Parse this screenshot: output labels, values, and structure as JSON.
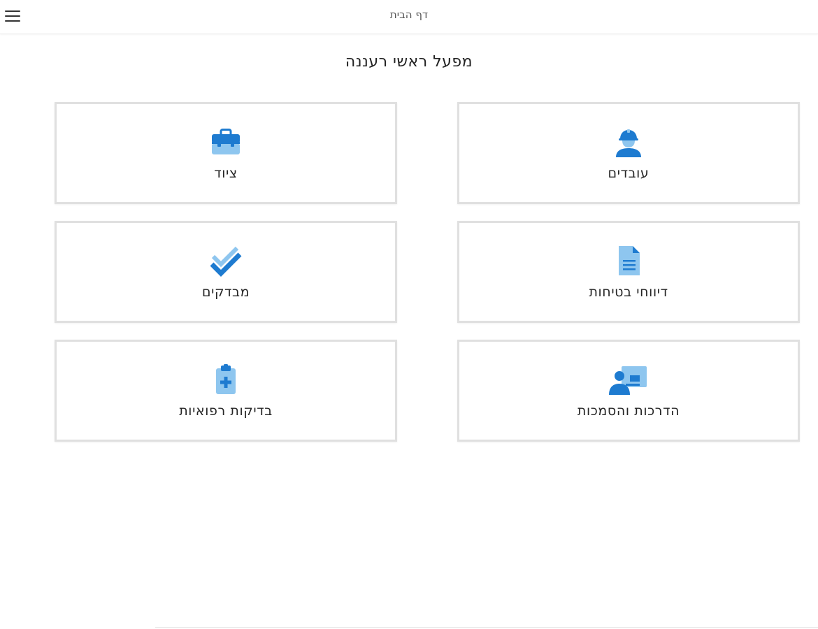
{
  "header": {
    "title": "דף הבית",
    "menu_icon": "hamburger-menu-icon"
  },
  "main": {
    "title": "מפעל ראשי רעננה",
    "tiles": [
      {
        "label": "עובדים",
        "icon": "construction-worker-icon"
      },
      {
        "label": "ציוד",
        "icon": "toolbox-icon"
      },
      {
        "label": "דיווחי בטיחות",
        "icon": "document-icon"
      },
      {
        "label": "מבדקים",
        "icon": "double-check-icon"
      },
      {
        "label": "הדרכות והסמכות",
        "icon": "presentation-trainer-icon"
      },
      {
        "label": "בדיקות רפואיות",
        "icon": "medical-clipboard-icon"
      }
    ]
  },
  "colors": {
    "accent_dark": "#1e7bd0",
    "accent_light": "#8ec6ef",
    "tile_border": "#e0e0e0"
  }
}
